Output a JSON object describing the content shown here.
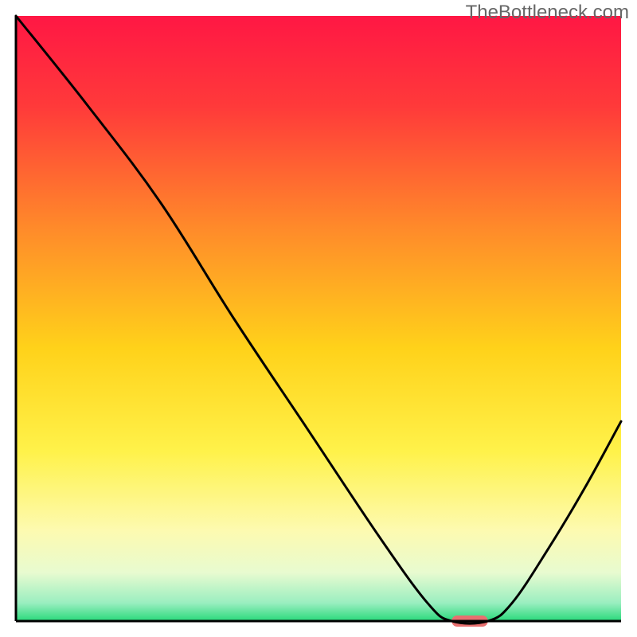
{
  "attribution": "TheBottleneck.com",
  "chart_data": {
    "type": "line",
    "title": "",
    "xlabel": "",
    "ylabel": "",
    "xlim": [
      0,
      100
    ],
    "ylim": [
      0,
      100
    ],
    "gradient_stops": [
      {
        "offset": 0.0,
        "color": "#ff1744"
      },
      {
        "offset": 0.15,
        "color": "#ff3a3a"
      },
      {
        "offset": 0.35,
        "color": "#ff8a2a"
      },
      {
        "offset": 0.55,
        "color": "#ffd21a"
      },
      {
        "offset": 0.72,
        "color": "#fff24a"
      },
      {
        "offset": 0.85,
        "color": "#fdfab0"
      },
      {
        "offset": 0.92,
        "color": "#e8fbd0"
      },
      {
        "offset": 0.97,
        "color": "#9aeec0"
      },
      {
        "offset": 1.0,
        "color": "#29d97a"
      }
    ],
    "curve_points": [
      {
        "x": 0,
        "y": 100
      },
      {
        "x": 12,
        "y": 85
      },
      {
        "x": 24,
        "y": 69
      },
      {
        "x": 36,
        "y": 50
      },
      {
        "x": 48,
        "y": 32
      },
      {
        "x": 60,
        "y": 14
      },
      {
        "x": 68,
        "y": 3
      },
      {
        "x": 72,
        "y": 0
      },
      {
        "x": 78,
        "y": 0
      },
      {
        "x": 82,
        "y": 3
      },
      {
        "x": 88,
        "y": 12
      },
      {
        "x": 94,
        "y": 22
      },
      {
        "x": 100,
        "y": 33
      }
    ],
    "marker": {
      "x_start": 72,
      "x_end": 78,
      "y": 0,
      "color": "#e87070"
    }
  },
  "plot": {
    "inner_left": 20,
    "inner_top": 20,
    "inner_width": 760,
    "inner_height": 760,
    "axis_color": "#000000",
    "axis_width": 3,
    "curve_color": "#000000",
    "curve_width": 3,
    "marker_thickness": 14
  }
}
